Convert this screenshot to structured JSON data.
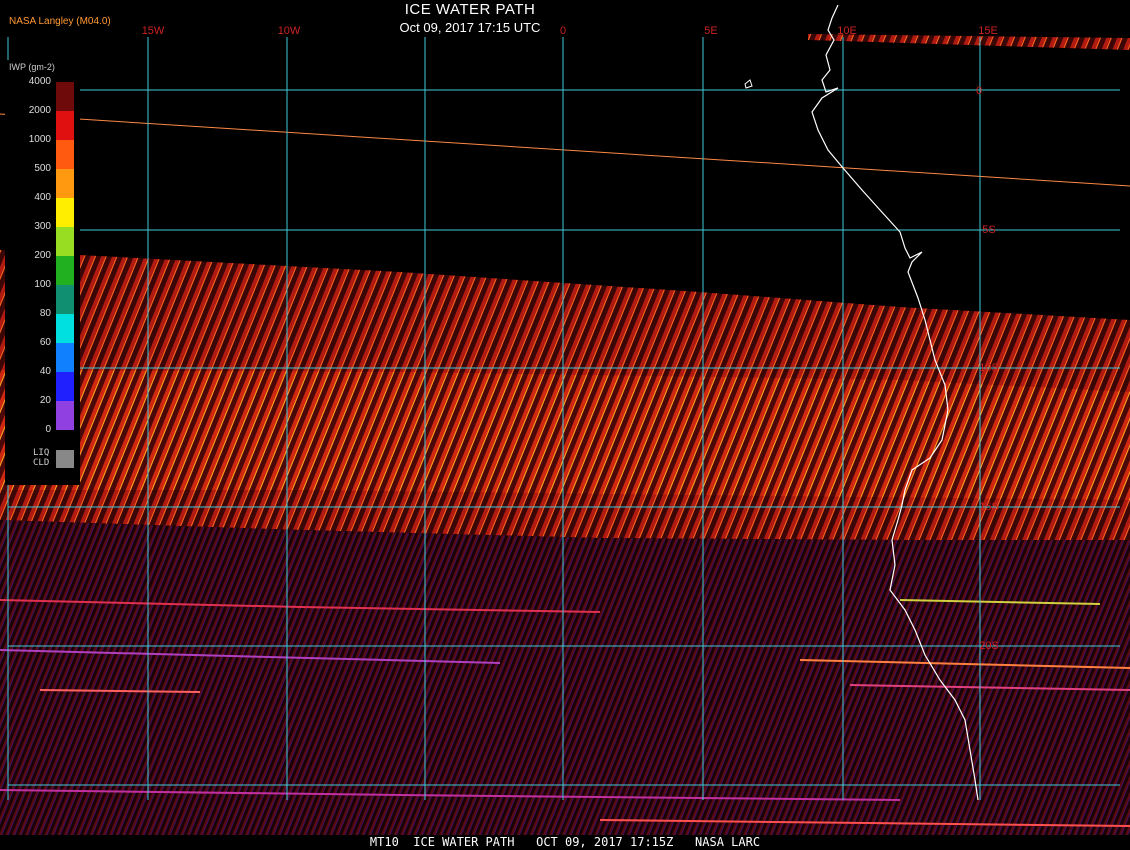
{
  "header": {
    "title": "ICE WATER PATH",
    "datetime": "Oct 09, 2017 17:15 UTC",
    "producer": "NASA Langley (M04.0)"
  },
  "footer": {
    "text": "MT10  ICE WATER PATH   OCT 09, 2017 17:15Z   NASA LARC"
  },
  "legend": {
    "title": "IWP (gm-2)",
    "labels": [
      "4000",
      "2000",
      "1000",
      "500",
      "400",
      "300",
      "200",
      "100",
      "80",
      "60",
      "40",
      "20",
      "0"
    ],
    "colors": [
      "#6e0a0a",
      "#e01010",
      "#ff5a10",
      "#ff9a10",
      "#ffee00",
      "#99dd22",
      "#20b020",
      "#109070",
      "#00e0e0",
      "#1080ff",
      "#2020ff",
      "#9040e0"
    ],
    "liq_label": "LIQ\nCLD",
    "liq_color": "#888888"
  },
  "map": {
    "longitude_labels": [
      "15W",
      "10W",
      "0",
      "5E",
      "10E",
      "15E"
    ],
    "latitude_labels": [
      "0",
      "5S",
      "10S",
      "15S",
      "20S"
    ],
    "grid_color": "#40c8d8",
    "coast_color": "#ffffff"
  }
}
